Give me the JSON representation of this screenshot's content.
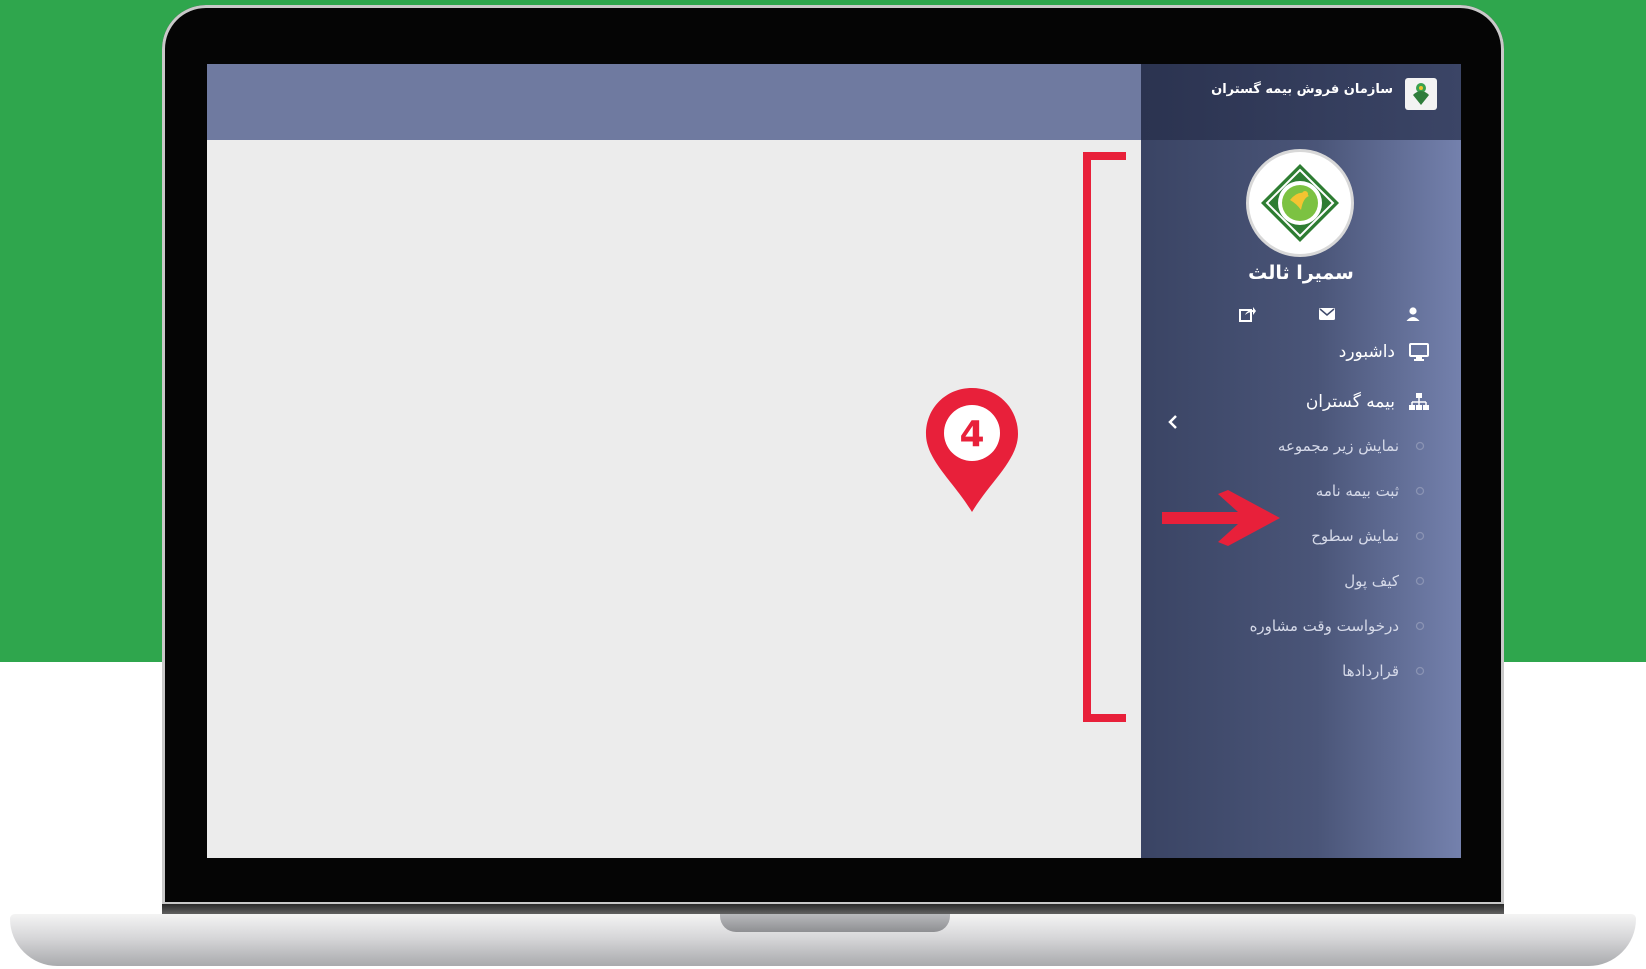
{
  "sidebar": {
    "brand_title": "سازمان فروش بیمه گستران",
    "user_name": "سمیرا ثالث",
    "icons": [
      "user-icon",
      "envelope-icon",
      "share-icon"
    ],
    "menu": [
      {
        "label": "داشبورد",
        "icon": "monitor-icon"
      },
      {
        "label": "بیمه گستران",
        "icon": "sitemap-icon"
      }
    ],
    "submenu": [
      {
        "label": "نمایش زیر مجموعه"
      },
      {
        "label": "ثبت بیمه نامه"
      },
      {
        "label": "نمایش سطوح"
      },
      {
        "label": "کیف پول"
      },
      {
        "label": "درخواست وقت مشاوره"
      },
      {
        "label": "قراردادها"
      }
    ]
  },
  "annotation": {
    "step_number": "4"
  },
  "colors": {
    "background_green": "#2fa64d",
    "topbar": "#6f7aa0",
    "sidebar_dark": "#3a4464",
    "annotation_red": "#e8203a"
  }
}
